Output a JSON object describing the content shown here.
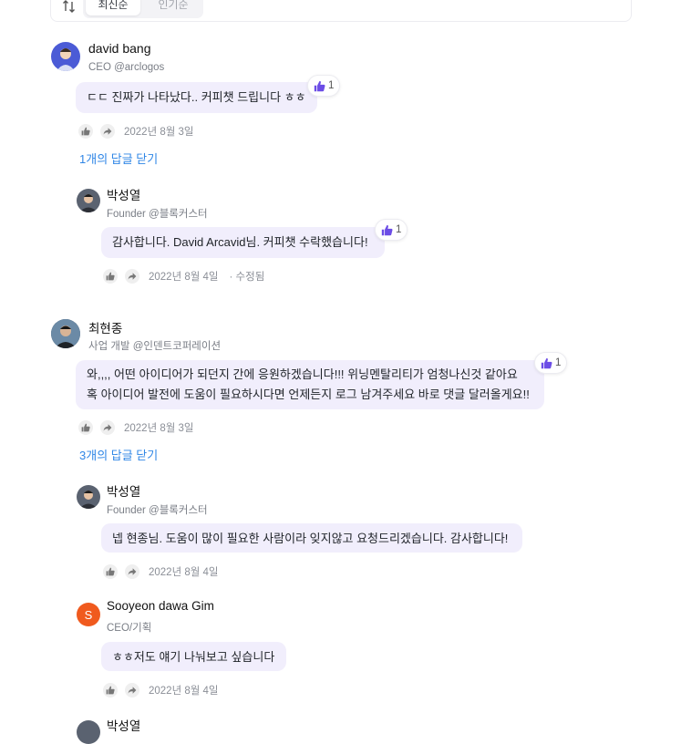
{
  "sort": {
    "active_label": "최신순",
    "inactive_label": "인기순"
  },
  "comments": [
    {
      "name": "david bang",
      "role": "CEO @arclogos",
      "text": "ㄷㄷ 진짜가 나타났다.. 커피챗 드립니다 ㅎㅎ",
      "likes": "1",
      "date": "2022년 8월 3일",
      "replies_toggle": "1개의 답글 닫기"
    },
    {
      "name": "박성열",
      "role": "Founder @블록커스터",
      "text": "감사합니다. David Arcavid님. 커피챗 수락했습니다!",
      "likes": "1",
      "date": "2022년 8월 4일",
      "edited": "· 수정됨"
    },
    {
      "name": "최현종",
      "role": "사업 개발 @인덴트코퍼레이션",
      "text_line1": "와,,,, 어떤 아이디어가 되던지 간에 응원하겠습니다!!! 위닝멘탈리티가 엄청나신것 같아요",
      "text_line2": "혹 아이디어 발전에 도움이 필요하시다면 언제든지 로그 남겨주세요 바로 댓글 달러올게요!!",
      "likes": "1",
      "date": "2022년 8월 3일",
      "replies_toggle": "3개의 답글 닫기"
    },
    {
      "name": "박성열",
      "role": "Founder @블록커스터",
      "text": "넵 현종님. 도움이 많이 필요한 사람이라 잊지않고 요청드리겠습니다. 감사합니다!",
      "date": "2022년 8월 4일"
    },
    {
      "name": "Sooyeon dawa Gim",
      "avatar_letter": "S",
      "role": "CEO/기획",
      "text": "ㅎㅎ저도 얘기 나눠보고 싶습니다",
      "date": "2022년 8월 4일"
    },
    {
      "name": "박성열"
    }
  ],
  "colors": {
    "bubble": "#f1eefc",
    "like_icon": "#6c4de6",
    "link": "#2f86e6",
    "s_avatar": "#f05a1e"
  }
}
